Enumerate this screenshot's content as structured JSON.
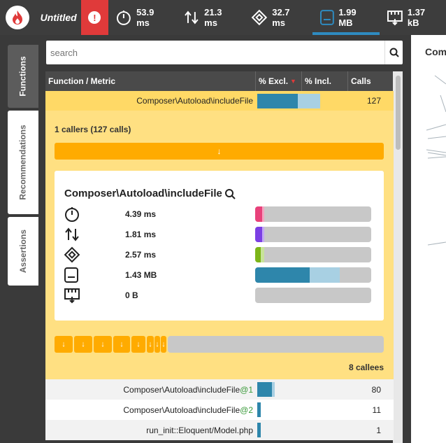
{
  "app": {
    "title": "Untitled"
  },
  "metrics": [
    {
      "icon": "clock-icon",
      "value": "53.9 ms"
    },
    {
      "icon": "io-arrows-icon",
      "value": "21.3 ms"
    },
    {
      "icon": "cpu-icon",
      "value": "32.7 ms"
    },
    {
      "icon": "memory-icon",
      "value": "1.99 MB",
      "active": true
    },
    {
      "icon": "network-icon",
      "value": "1.37 kB"
    }
  ],
  "tabs": [
    "Functions",
    "Recommendations",
    "Assertions"
  ],
  "search": {
    "placeholder": "search"
  },
  "table": {
    "headers": [
      "Function / Metric",
      "% Excl.",
      "% Incl.",
      "Calls"
    ],
    "selected": {
      "name": "Composer\\Autoload\\includeFile",
      "calls": "127",
      "excl_pct": 58,
      "incl_pct": 100
    }
  },
  "detail": {
    "callers": "1 callers (127 calls)",
    "caller_arrow": "↓",
    "title": "Composer\\Autoload\\includeFile",
    "metrics": [
      {
        "icon": "clock-icon",
        "value": "4.39 ms",
        "excl": 0.06,
        "incl": 0.08,
        "color": "#e8417a",
        "incl_color": "#f4a3c0"
      },
      {
        "icon": "io-arrows-icon",
        "value": "1.81 ms",
        "excl": 0.06,
        "incl": 0.08,
        "color": "#7b3fe4",
        "incl_color": "#c4a8f4"
      },
      {
        "icon": "cpu-icon",
        "value": "2.57 ms",
        "excl": 0.05,
        "incl": 0.08,
        "color": "#7cb518",
        "incl_color": "#c8e39a"
      },
      {
        "icon": "memory-icon",
        "value": "1.43 MB",
        "excl": 0.47,
        "incl": 0.73,
        "color": "#2e86ab",
        "incl_color": "#a8d0e3"
      },
      {
        "icon": "network-icon",
        "value": "0 B",
        "excl": 0,
        "incl": 0,
        "color": "#2e86ab",
        "incl_color": "#a8d0e3"
      }
    ],
    "callee_arrows": [
      "↓",
      "↓",
      "↓",
      "↓",
      "↓",
      "↓",
      "↓",
      "↓"
    ],
    "callees": "8 callees"
  },
  "rows": [
    {
      "name": "Composer\\Autoload\\includeFile",
      "at": "@1",
      "excl": 0.16,
      "incl": 0.19,
      "calls": "80"
    },
    {
      "name": "Composer\\Autoload\\includeFile",
      "at": "@2",
      "excl": 0.04,
      "incl": 0.04,
      "calls": "11"
    },
    {
      "name": "run_init::Eloquent/Model.php",
      "at": "",
      "excl": 0.04,
      "incl": 0.04,
      "calls": "1"
    }
  ],
  "right_panel": {
    "title": "Com"
  },
  "colors": {
    "accent": "#ffab00",
    "highlight": "#ffd966",
    "bar": "#2e86ab",
    "alert": "#e03a3a"
  }
}
